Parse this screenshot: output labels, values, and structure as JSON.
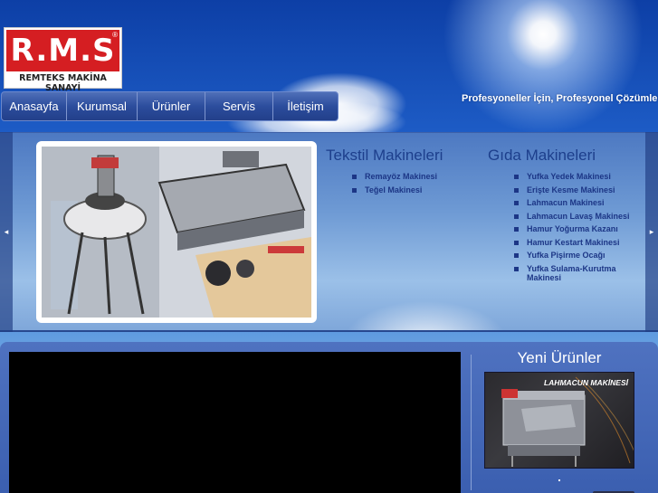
{
  "logo": {
    "letters": "R.M.S",
    "registered": "®",
    "subtitle": "REMTEKS MAKİNA SANAYİ"
  },
  "nav": {
    "items": [
      "Anasayfa",
      "Kurumsal",
      "Ürünler",
      "Servis",
      "İletişim"
    ]
  },
  "tagline": "Profesyoneller İçin, Profesyonel Çözümler...",
  "slider": {
    "prev_arrow": "◂",
    "next_arrow": "▸"
  },
  "categories": [
    {
      "title": "Tekstil Makineleri",
      "items": [
        "Remayöz Makinesi",
        "Teğel Makinesi"
      ]
    },
    {
      "title": "Gıda Makineleri",
      "items": [
        "Yufka Yedek Makinesi",
        "Erişte Kesme Makinesi",
        "Lahmacun Makinesi",
        "Lahmacun Lavaş Makinesi",
        "Hamur Yoğurma Kazanı",
        "Hamur Kestart Makinesi",
        "Yufka Pişirme Ocağı",
        "Yufka Sulama-Kurutma Makinesi"
      ]
    }
  ],
  "new_products": {
    "title": "Yeni Ürünler",
    "caption": "LAHMACUN MAKİNESİ"
  },
  "colors": {
    "brand_red": "#d51e22",
    "nav_blue": "#2c4d9d",
    "text_blue": "#1c3686"
  }
}
